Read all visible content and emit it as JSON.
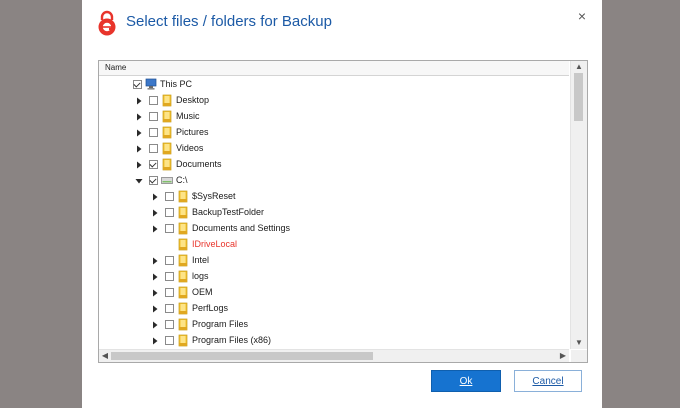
{
  "dialog": {
    "title": "Select files / folders for Backup",
    "close_glyph": "×",
    "accent_color": "#1c5aa6",
    "brand_color": "#e8342b"
  },
  "tree": {
    "column_header": "Name",
    "rows": [
      {
        "label": "This PC",
        "level": 0,
        "expander": "none",
        "checked": true,
        "icon": "computer-icon",
        "red": false
      },
      {
        "label": "Desktop",
        "level": 1,
        "expander": "collapsed",
        "checked": false,
        "icon": "folder-icon",
        "red": false
      },
      {
        "label": "Music",
        "level": 1,
        "expander": "collapsed",
        "checked": false,
        "icon": "folder-icon",
        "red": false
      },
      {
        "label": "Pictures",
        "level": 1,
        "expander": "collapsed",
        "checked": false,
        "icon": "folder-icon",
        "red": false
      },
      {
        "label": "Videos",
        "level": 1,
        "expander": "collapsed",
        "checked": false,
        "icon": "folder-icon",
        "red": false
      },
      {
        "label": "Documents",
        "level": 1,
        "expander": "collapsed",
        "checked": true,
        "icon": "folder-icon",
        "red": false
      },
      {
        "label": "C:\\",
        "level": 1,
        "expander": "expanded",
        "checked": true,
        "icon": "drive-icon",
        "red": false
      },
      {
        "label": "$SysReset",
        "level": 2,
        "expander": "collapsed",
        "checked": false,
        "icon": "folder-icon",
        "red": false
      },
      {
        "label": "BackupTestFolder",
        "level": 2,
        "expander": "collapsed",
        "checked": false,
        "icon": "folder-icon",
        "red": false
      },
      {
        "label": "Documents and Settings",
        "level": 2,
        "expander": "collapsed",
        "checked": false,
        "icon": "folder-icon",
        "red": false
      },
      {
        "label": "IDriveLocal",
        "level": 2,
        "expander": "none",
        "checked": null,
        "icon": "folder-icon",
        "red": true
      },
      {
        "label": "Intel",
        "level": 2,
        "expander": "collapsed",
        "checked": false,
        "icon": "folder-icon",
        "red": false
      },
      {
        "label": "logs",
        "level": 2,
        "expander": "collapsed",
        "checked": false,
        "icon": "folder-icon",
        "red": false
      },
      {
        "label": "OEM",
        "level": 2,
        "expander": "collapsed",
        "checked": false,
        "icon": "folder-icon",
        "red": false
      },
      {
        "label": "PerfLogs",
        "level": 2,
        "expander": "collapsed",
        "checked": false,
        "icon": "folder-icon",
        "red": false
      },
      {
        "label": "Program Files",
        "level": 2,
        "expander": "collapsed",
        "checked": false,
        "icon": "folder-icon",
        "red": false
      },
      {
        "label": "Program Files (x86)",
        "level": 2,
        "expander": "collapsed",
        "checked": false,
        "icon": "folder-icon",
        "red": false
      }
    ]
  },
  "buttons": {
    "ok_label": "Ok",
    "cancel_label": "Cancel"
  }
}
